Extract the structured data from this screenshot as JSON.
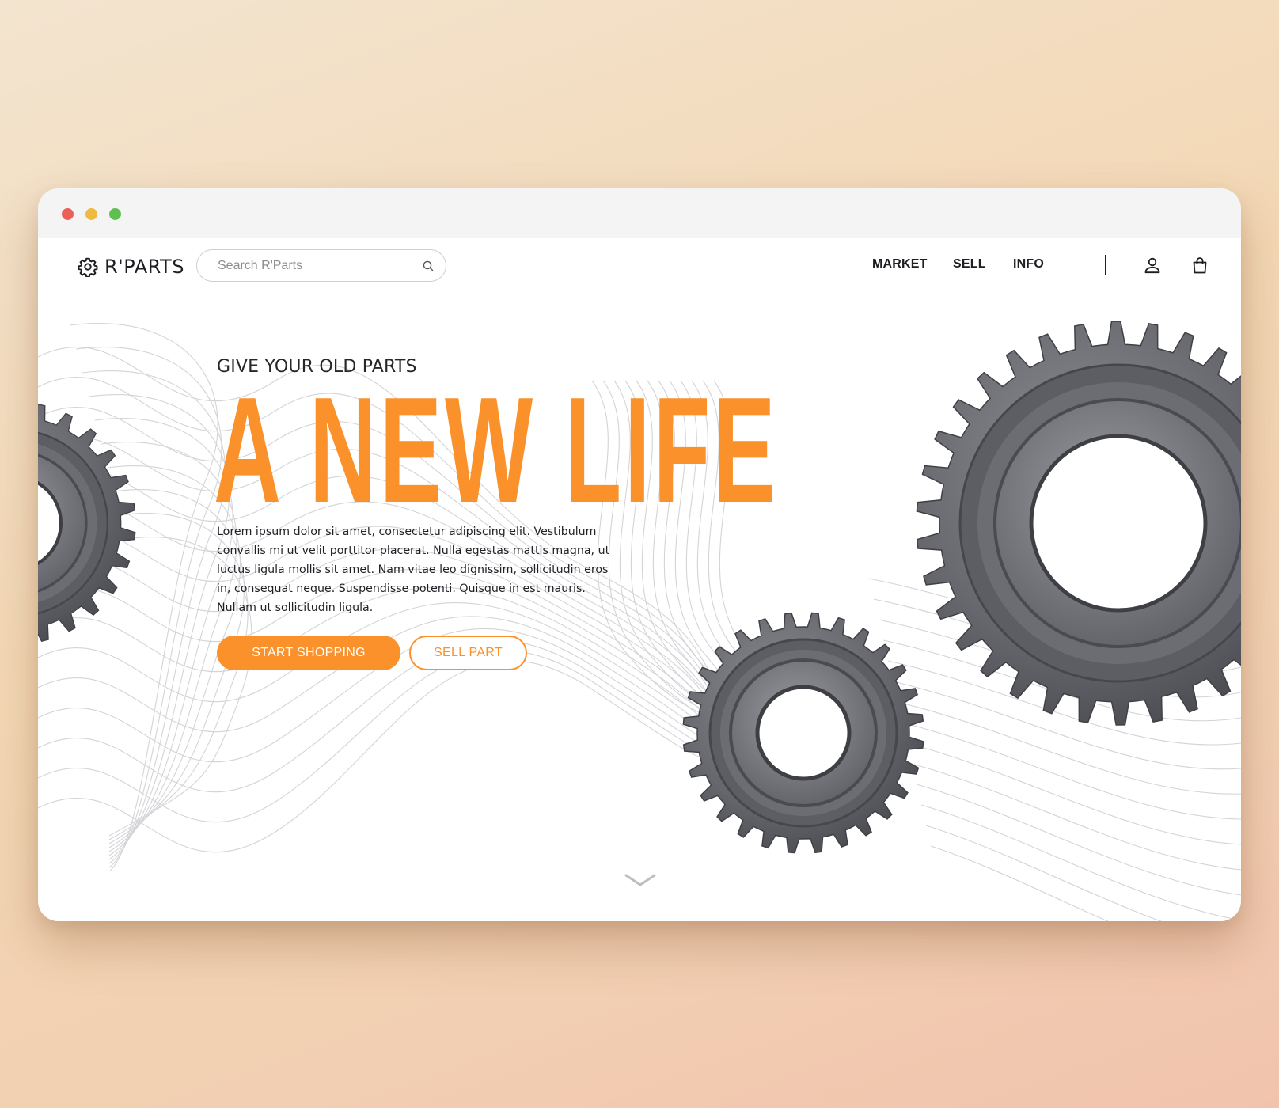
{
  "window": {
    "controls": [
      "close",
      "minimize",
      "maximize"
    ]
  },
  "nav": {
    "logo_text": "R'PARTS",
    "logo_icon": "gear-icon",
    "search_placeholder": "Search R'Parts",
    "search_icon": "search-icon",
    "links": [
      "MARKET",
      "SELL",
      "INFO"
    ],
    "account_icon": "user-icon",
    "cart_icon": "shopping-bag-icon"
  },
  "hero": {
    "eyebrow": "GIVE YOUR OLD PARTS",
    "headline": "A NEW LIFE",
    "body": "Lorem ipsum dolor sit amet, consectetur adipiscing elit. Vestibulum convallis mi ut velit porttitor placerat. Nulla egestas mattis magna, ut luctus ligula mollis sit amet. Nam vitae leo dignissim, sollicitudin eros in, consequat neque. Suspendisse potenti. Quisque in est mauris. Nullam ut sollicitudin ligula.",
    "primary_button": "START SHOPPING",
    "secondary_button": "SELL PART",
    "scroll_icon": "chevron-down-icon"
  },
  "colors": {
    "accent": "#fb912b",
    "text": "#1d1d22",
    "background_gradient_start": "#f3e4cf",
    "background_gradient_end": "#f1c3ad"
  }
}
